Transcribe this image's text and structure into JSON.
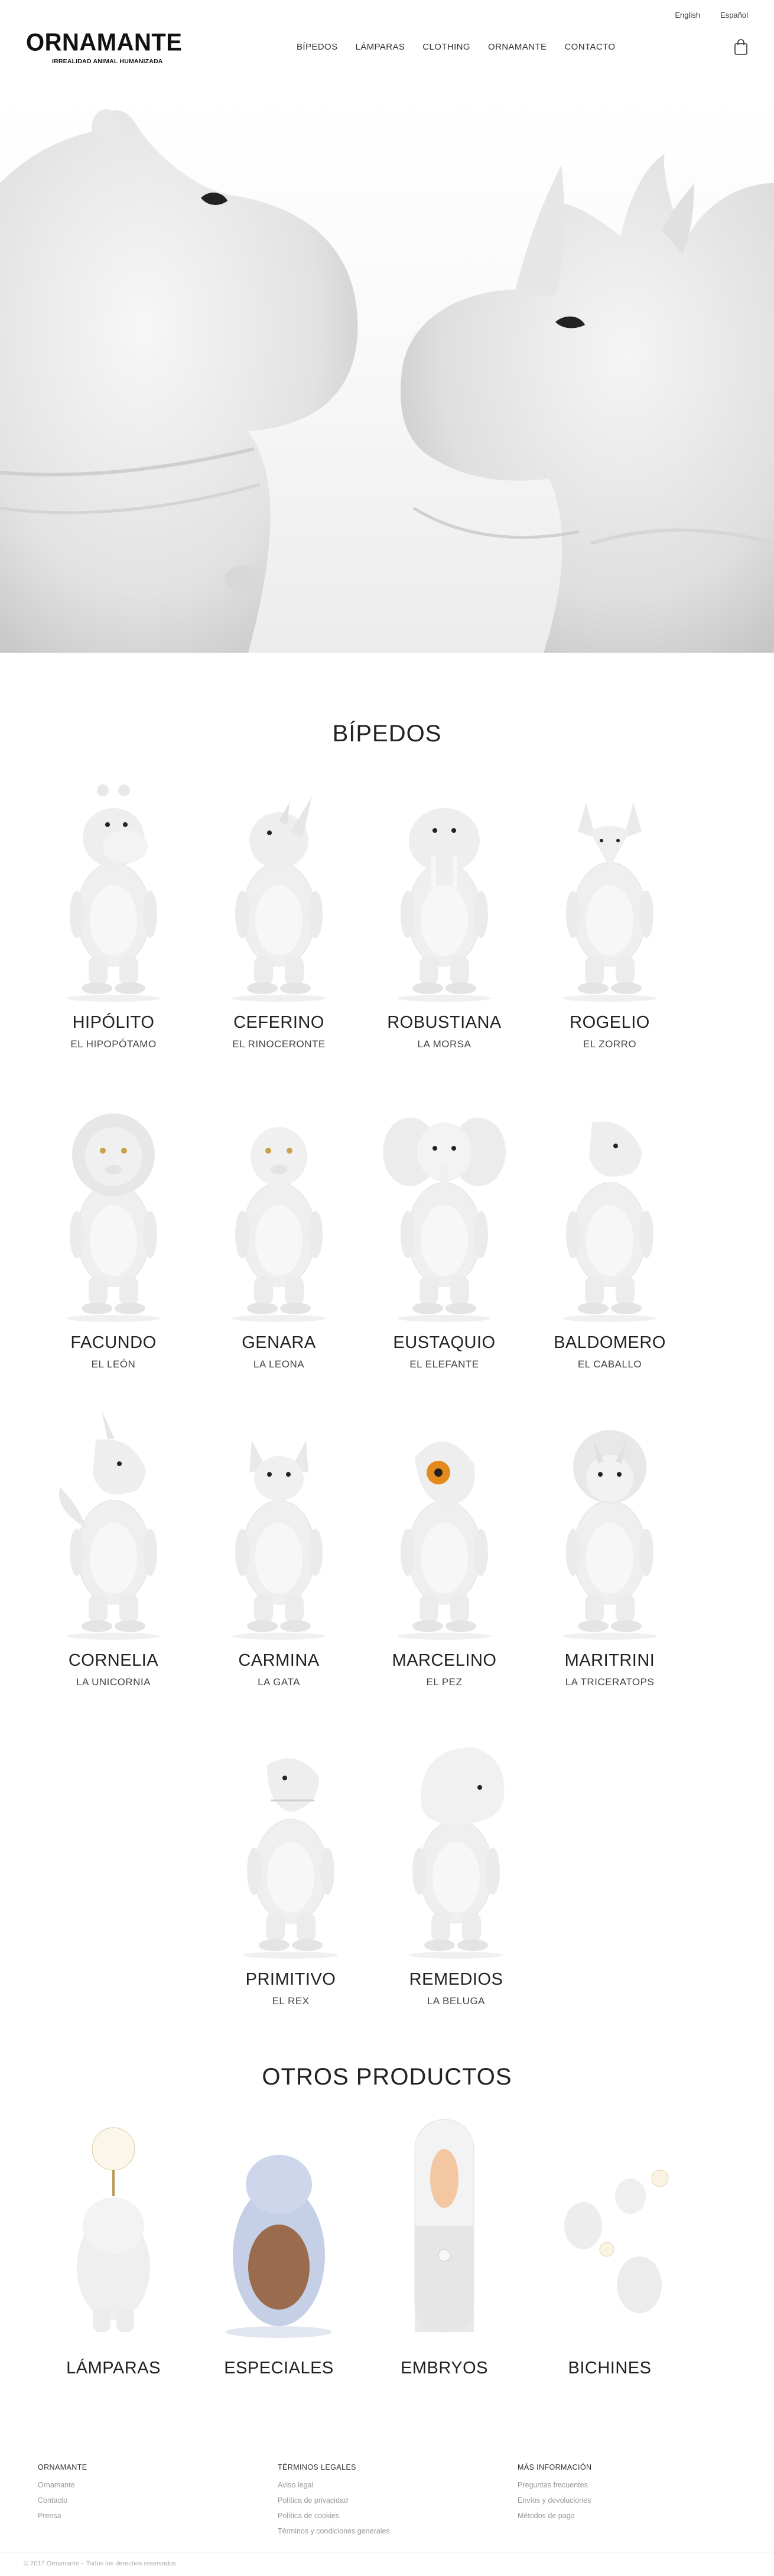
{
  "header": {
    "languages": [
      "English",
      "Español"
    ],
    "logo_text": "ORNAMANTE",
    "logo_tagline": "IRREALIDAD ANIMAL HUMANIZADA",
    "nav": [
      "BÍPEDOS",
      "LÁMPARAS",
      "CLOTHING",
      "ORNAMANTE",
      "CONTACTO"
    ],
    "cart_icon": "shopping-bag-icon"
  },
  "hero": {
    "left_subject": "hippo-head",
    "right_subject": "rhino-head"
  },
  "bipedos": {
    "title": "BÍPEDOS",
    "items": [
      {
        "name": "HIPÓLITO",
        "sub": "EL HIPOPÓTAMO",
        "animal": "hippo"
      },
      {
        "name": "CEFERINO",
        "sub": "EL RINOCERONTE",
        "animal": "rhino"
      },
      {
        "name": "ROBUSTIANA",
        "sub": "LA MORSA",
        "animal": "walrus"
      },
      {
        "name": "ROGELIO",
        "sub": "EL ZORRO",
        "animal": "fox"
      },
      {
        "name": "FACUNDO",
        "sub": "EL LEÓN",
        "animal": "lion"
      },
      {
        "name": "GENARA",
        "sub": "LA LEONA",
        "animal": "lioness"
      },
      {
        "name": "EUSTAQUIO",
        "sub": "EL ELEFANTE",
        "animal": "elephant"
      },
      {
        "name": "BALDOMERO",
        "sub": "EL CABALLO",
        "animal": "horse"
      },
      {
        "name": "CORNELIA",
        "sub": "LA UNICORNIA",
        "animal": "unicorn"
      },
      {
        "name": "CARMINA",
        "sub": "LA GATA",
        "animal": "cat"
      },
      {
        "name": "MARCELINO",
        "sub": "EL PEZ",
        "animal": "fish"
      },
      {
        "name": "MARITRINI",
        "sub": "LA TRICERATOPS",
        "animal": "triceratops"
      },
      {
        "name": "PRIMITIVO",
        "sub": "EL REX",
        "animal": "trex"
      },
      {
        "name": "REMEDIOS",
        "sub": "LA BELUGA",
        "animal": "beluga"
      }
    ]
  },
  "otros": {
    "title": "OTROS PRODUCTOS",
    "items": [
      {
        "name": "LÁMPARAS",
        "kind": "lamp"
      },
      {
        "name": "ESPECIALES",
        "kind": "special"
      },
      {
        "name": "EMBRYOS",
        "kind": "embryo"
      },
      {
        "name": "BICHINES",
        "kind": "bichines"
      }
    ]
  },
  "footer": {
    "columns": [
      {
        "heading": "ORNAMANTE",
        "links": [
          "Ornamante",
          "Contacto",
          "Prensa"
        ]
      },
      {
        "heading": "TÉRMINOS LEGALES",
        "links": [
          "Aviso legal",
          "Política de privacidad",
          "Política de cookies",
          "Términos y condiciones generales"
        ]
      },
      {
        "heading": "MÁS INFORMACIÓN",
        "links": [
          "Preguntas frecuentes",
          "Envíos y devoluciones",
          "Métodos de pago"
        ]
      }
    ],
    "copyright": "© 2017 Ornamante – Todos los derechos reservados"
  }
}
